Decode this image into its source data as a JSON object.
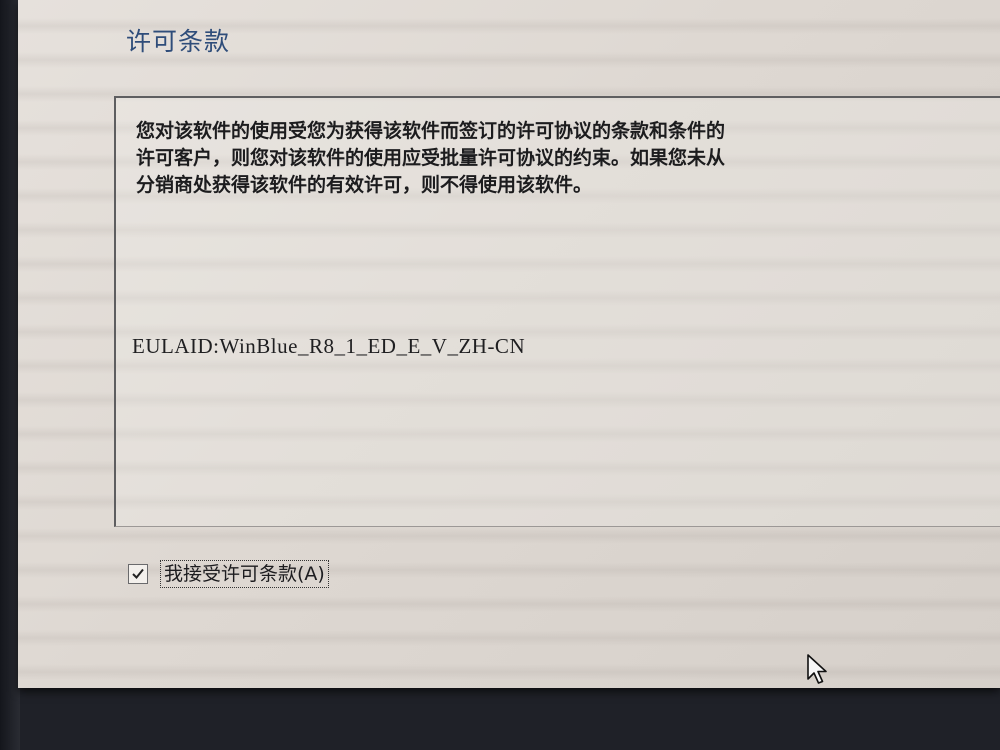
{
  "page": {
    "title": "许可条款"
  },
  "license": {
    "lines": [
      "您对该软件的使用受您为获得该软件而签订的许可协议的条款和条件的",
      "许可客户，则您对该软件的使用应受批量许可协议的约束。如果您未从",
      "分销商处获得该软件的有效许可，则不得使用该软件。"
    ],
    "eula_id": "EULAID:WinBlue_R8_1_ED_E_V_ZH-CN"
  },
  "accept": {
    "label": "我接受许可条款(A)",
    "checked": true
  },
  "icons": {
    "checkbox": "checkmark-icon",
    "cursor": "mouse-pointer-icon"
  }
}
